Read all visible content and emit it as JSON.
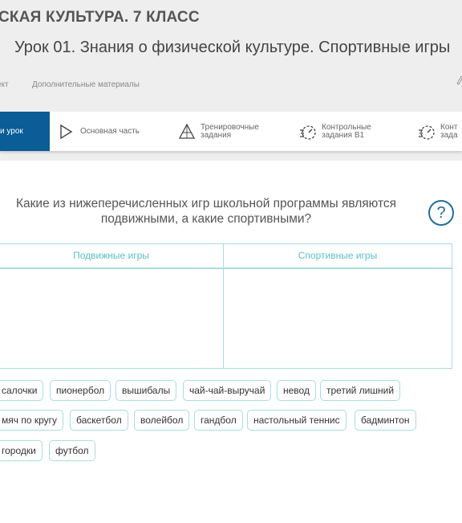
{
  "header": {
    "course_title": "СКАЯ КУЛЬТУРА. 7 КЛАСС",
    "lesson_title": "Урок 01. Знания о физической культуре. Спортивные игры",
    "subnav": {
      "project": "ект",
      "extra": "Дополнительные материалы"
    },
    "edge_icon": "pencil-icon"
  },
  "tabs": [
    {
      "label": "и урок",
      "icon": "none",
      "active": true
    },
    {
      "label": "Основная часть",
      "icon": "play-icon"
    },
    {
      "label_line1": "Тренировочные",
      "label_line2": "задания",
      "icon": "triangle-icon"
    },
    {
      "label_line1": "Контрольные",
      "label_line2": "задания В1",
      "icon": "timer-icon"
    },
    {
      "label_line1": "Конт",
      "label_line2": "зада",
      "icon": "timer-icon"
    }
  ],
  "task": {
    "question_line1": "Какие из нижеперечисленных игр школьной программы являются",
    "question_line2": "подвижными, а какие спортивными?",
    "help_symbol": "?",
    "columns": [
      "Подвижные игры",
      "Спортивные игры"
    ]
  },
  "options": [
    "салочки",
    "пионербол",
    "вышибалы",
    "чай-чай-выручай",
    "невод",
    "третий лишний",
    "мяч по кругу",
    "баскетбол",
    "волейбол",
    "гандбол",
    "настольный теннис",
    "бадминтон",
    "городки",
    "футбол"
  ],
  "colors": {
    "accent": "#0a5d96",
    "teal": "#5ac0c8",
    "border": "#a9dde0"
  }
}
